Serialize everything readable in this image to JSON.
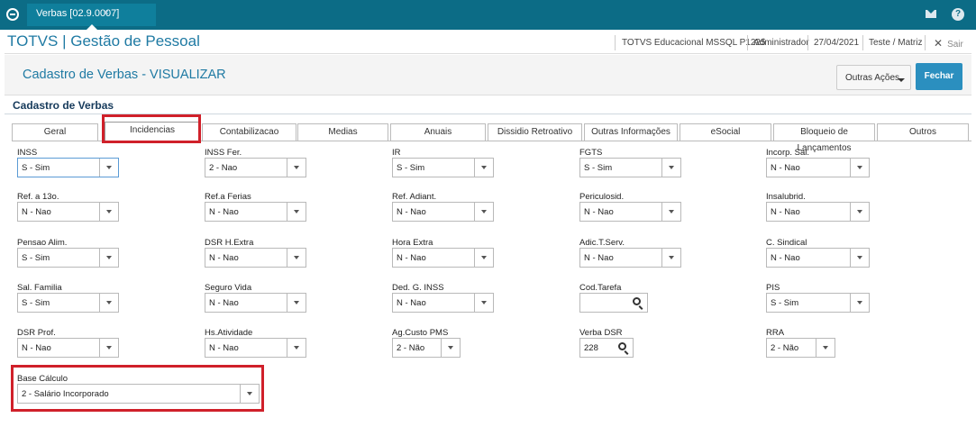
{
  "window": {
    "tab_label": "Verbas [02.9.0007]",
    "tab_close": "×"
  },
  "header": {
    "app_title": "TOTVS | Gestão de Pessoal",
    "environment": "TOTVS Educacional MSSQL P1225",
    "user": "Administrador",
    "date": "27/04/2021",
    "company": "Teste / Matriz",
    "exit_label": "Sair"
  },
  "page": {
    "title": "Cadastro de Verbas - VISUALIZAR",
    "other_actions": "Outras Ações",
    "close": "Fechar",
    "section_title": "Cadastro de Verbas"
  },
  "tabs": [
    "Geral",
    "Incidencias",
    "Contabilizacao",
    "Medias",
    "Anuais",
    "Dissidio Retroativo",
    "Outras Informações",
    "eSocial",
    "Bloqueio de Lançamentos",
    "Outros"
  ],
  "active_tab": "Incidencias",
  "fields": [
    {
      "label": "INSS",
      "value": "S - Sim",
      "kind": "select"
    },
    {
      "label": "INSS Fer.",
      "value": "2 - Nao",
      "kind": "select"
    },
    {
      "label": "IR",
      "value": "S - Sim",
      "kind": "select"
    },
    {
      "label": "FGTS",
      "value": "S - Sim",
      "kind": "select"
    },
    {
      "label": "Incorp. Sal.",
      "value": "N - Nao",
      "kind": "select"
    },
    {
      "label": "Ref. a 13o.",
      "value": "N - Nao",
      "kind": "select"
    },
    {
      "label": "Ref.a Ferias",
      "value": "N - Nao",
      "kind": "select"
    },
    {
      "label": "Ref. Adiant.",
      "value": "N - Nao",
      "kind": "select"
    },
    {
      "label": "Periculosid.",
      "value": "N - Nao",
      "kind": "select"
    },
    {
      "label": "Insalubrid.",
      "value": "N - Nao",
      "kind": "select"
    },
    {
      "label": "Pensao Alim.",
      "value": "S - Sim",
      "kind": "select"
    },
    {
      "label": "DSR H.Extra",
      "value": "N - Nao",
      "kind": "select"
    },
    {
      "label": "Hora Extra",
      "value": "N - Nao",
      "kind": "select"
    },
    {
      "label": "Adic.T.Serv.",
      "value": "N - Nao",
      "kind": "select"
    },
    {
      "label": "C. Sindical",
      "value": "N - Nao",
      "kind": "select"
    },
    {
      "label": "Sal. Familia",
      "value": "S - Sim",
      "kind": "select"
    },
    {
      "label": "Seguro Vida",
      "value": "N - Nao",
      "kind": "select"
    },
    {
      "label": "Ded. G. INSS",
      "value": "N - Nao",
      "kind": "select"
    },
    {
      "label": "Cod.Tarefa",
      "value": "",
      "kind": "search"
    },
    {
      "label": "PIS",
      "value": "S - Sim",
      "kind": "select"
    },
    {
      "label": "DSR Prof.",
      "value": "N - Nao",
      "kind": "select"
    },
    {
      "label": "Hs.Atividade",
      "value": "N - Nao",
      "kind": "select"
    },
    {
      "label": "Ag.Custo PMS",
      "value": "2 - Não",
      "kind": "select-short"
    },
    {
      "label": "Verba DSR",
      "value": "228",
      "kind": "search"
    },
    {
      "label": "RRA",
      "value": "2 - Não",
      "kind": "select-short"
    },
    {
      "label": "Base Cálculo",
      "value": "2 - Salário Incorporado",
      "kind": "select-wide"
    }
  ],
  "colors": {
    "topbar": "#0c6c86",
    "accent": "#1f7aa3",
    "primary_button": "#2b8fbf",
    "highlight": "#d0202a"
  }
}
